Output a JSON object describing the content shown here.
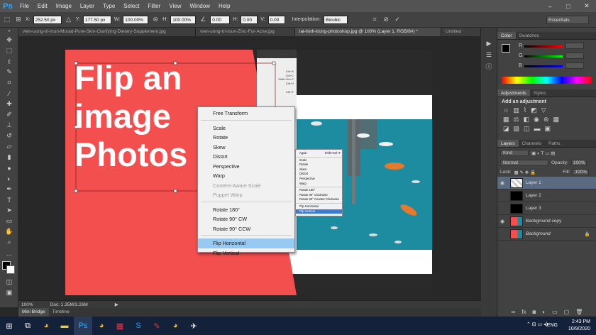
{
  "app": {
    "logo": "Ps"
  },
  "menubar": [
    "File",
    "Edit",
    "Image",
    "Layer",
    "Type",
    "Select",
    "Filter",
    "View",
    "Window",
    "Help"
  ],
  "window_controls": [
    "–",
    "□",
    "✕"
  ],
  "options": {
    "x_label": "X:",
    "x_value": "252.50 px",
    "y_label": "Y:",
    "y_value": "177.50 px",
    "w_label": "W:",
    "w_value": "100.00%",
    "h_label": "H:",
    "h_value": "100.00%",
    "rot_value": "0.00",
    "h_skew_label": "H:",
    "h_skew_value": "0.00",
    "v_skew_label": "V:",
    "v_skew_value": "0.00",
    "interp_label": "Interpolation:",
    "interp_value": "Bicubic",
    "workspace": "Essentials"
  },
  "tabs": [
    "vien-uong-tri-mun-Murad-Pure-Skin-Clarifying-Dietary-Supplement.jpg",
    "vien-uong-tri-mun-Zinc-For-Acne.jpg",
    "lat-hinh-trong-photoshop.jpg @ 100% (Layer 1, RGB/8#) *",
    "Untitled"
  ],
  "canvas": {
    "text_line1": "Flip an",
    "text_line2": "image",
    "text_line3": "Photos",
    "accent": "#f44f4f",
    "water": "#1e8ca0"
  },
  "context_menu": {
    "items": [
      "Free Transform",
      "Scale",
      "Rotate",
      "Skew",
      "Distort",
      "Perspective",
      "Warp",
      "Content-Aware Scale",
      "Puppet Warp",
      "Rotate 180°",
      "Rotate 90° CW",
      "Rotate 90° CCW",
      "Flip Horizontal",
      "Flip Vertical"
    ]
  },
  "mini_menu": {
    "items": [
      "Again",
      "Scale",
      "Rotate",
      "Skew",
      "Distort",
      "Perspective",
      "Warp",
      "Rotate 180°",
      "Rotate 90° Clockwise",
      "Rotate 90° Counter Clockwise",
      "Flip Horizontal",
      "Flip Vertical"
    ],
    "again_shortcut": "Shift+Ctrl+T"
  },
  "side_shortcuts": [
    "Shift+Ctrl+Z",
    "Alt+Ctrl+Z",
    "Ctrl+X",
    "Ctrl+C",
    "Shift+Ctrl+C",
    "Ctrl+V",
    "Ctrl+F"
  ],
  "status": {
    "zoom": "100%",
    "doc": "Doc: 1.35M/3.26M"
  },
  "bottom_tabs": [
    "Mini Bridge",
    "Timeline"
  ],
  "panels": {
    "color_tabs": [
      "Color",
      "Swatches"
    ],
    "color_labels": [
      "R",
      "G",
      "B"
    ],
    "adj_tabs": [
      "Adjustments",
      "Styles"
    ],
    "adj_title": "Add an adjustment",
    "layer_tabs": [
      "Layers",
      "Channels",
      "Paths"
    ],
    "kind": "Kind",
    "blend": "Normal",
    "opacity_label": "Opacity:",
    "opacity": "100%",
    "lock_label": "Lock:",
    "fill_label": "Fill:",
    "fill": "100%",
    "layers": [
      "Layer 1",
      "Layer 2",
      "Layer 3",
      "Background copy",
      "Background"
    ]
  },
  "taskbar": {
    "lang": "ENG",
    "time": "2:43 PM",
    "date": "10/9/2020"
  }
}
